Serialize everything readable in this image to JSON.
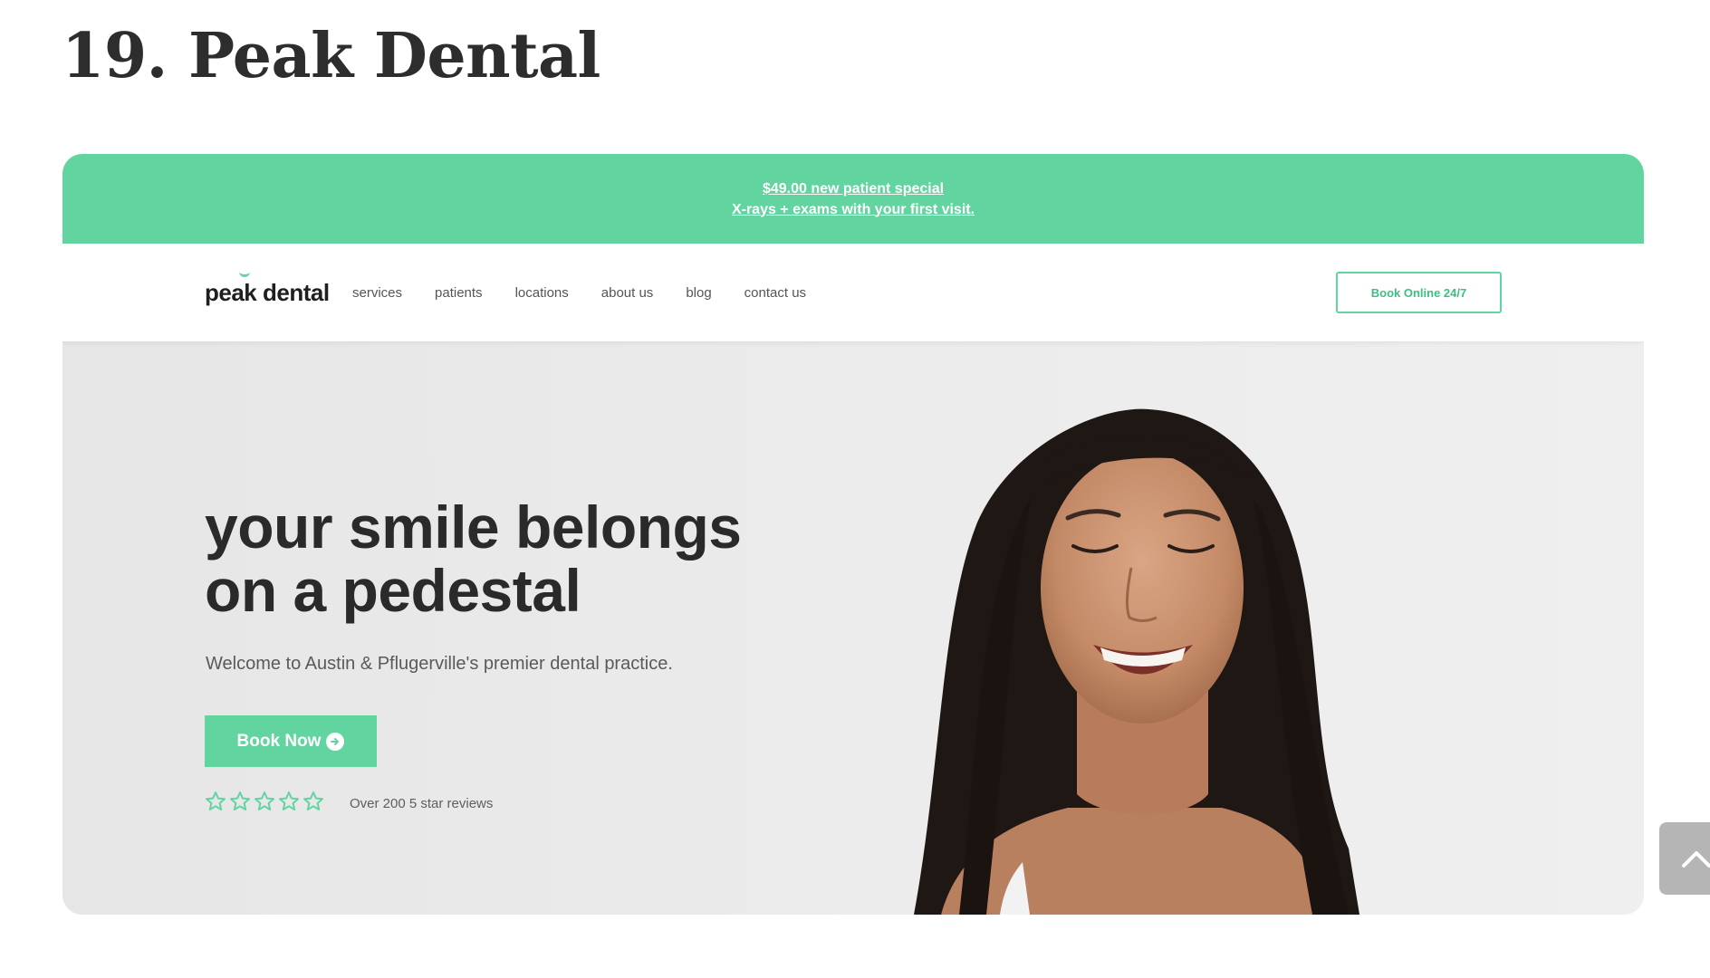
{
  "article": {
    "title": "19. Peak Dental"
  },
  "promo": {
    "line1": "$49.00 new patient special",
    "line2": "X-rays + exams with your first visit."
  },
  "nav": {
    "logo": "peak dental",
    "links": [
      "services",
      "patients",
      "locations",
      "about us",
      "blog",
      "contact us"
    ],
    "cta": "Book Online 24/7"
  },
  "hero": {
    "headline_line1": "your smile belongs",
    "headline_line2": "on a pedestal",
    "subtitle": "Welcome to Austin & Pflugerville's premier dental practice.",
    "button": "Book Now",
    "rating_stars": 5,
    "reviews": "Over 200 5 star reviews"
  },
  "colors": {
    "brand_green": "#62d49f",
    "text_dark": "#2a2a2a",
    "hero_bg": "#ebebeb"
  },
  "icons": [
    "arrow-right-circle-icon",
    "star-outline-icon",
    "chevron-up-icon"
  ]
}
